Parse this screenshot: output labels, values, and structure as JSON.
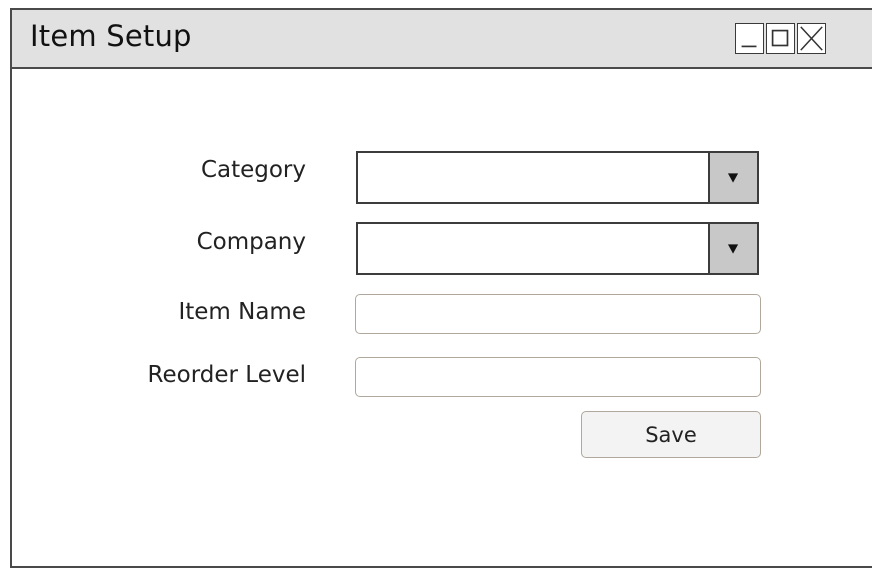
{
  "window": {
    "title": "Item Setup",
    "controls": {
      "minimize_icon": "minimize-icon",
      "maximize_icon": "maximize-icon",
      "close_icon": "close-icon"
    }
  },
  "form": {
    "fields": {
      "category": {
        "label": "Category",
        "value": "",
        "type": "select"
      },
      "company": {
        "label": "Company",
        "value": "",
        "type": "select"
      },
      "item_name": {
        "label": "Item Name",
        "value": "",
        "placeholder": ""
      },
      "reorder_level": {
        "label": "Reorder Level",
        "value": "",
        "placeholder": ""
      }
    },
    "save_label": "Save"
  },
  "colors": {
    "titlebar_bg": "#e1e1e1",
    "border": "#4a4a4a",
    "dropdown_arrow_bg": "#c8c8c8",
    "textfield_border": "#b0a89d",
    "button_bg": "#f3f3f3"
  }
}
